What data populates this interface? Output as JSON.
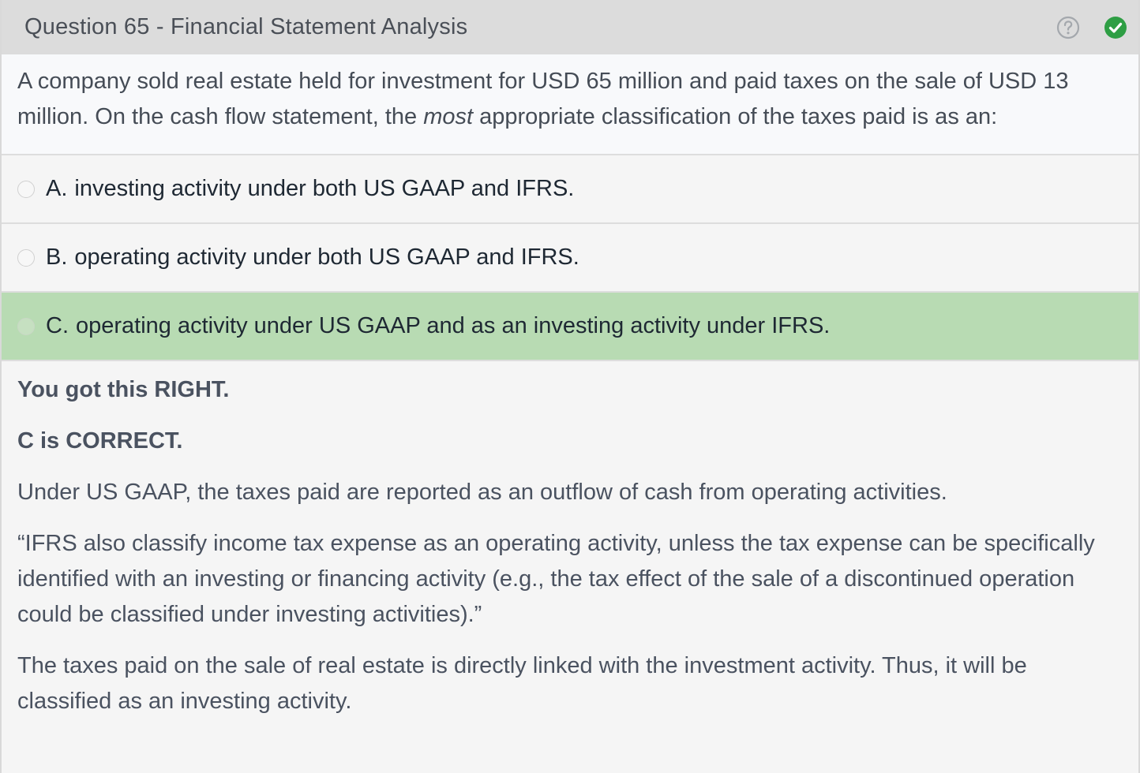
{
  "header": {
    "title": "Question 65 - Financial Statement Analysis",
    "help_icon": "question-circle-icon",
    "status_icon": "check-circle-icon",
    "status_color": "#2e9e44"
  },
  "question": {
    "stem_part1": "A company sold real estate held for investment for USD 65 million and paid taxes on the sale of USD 13 million.  On the cash flow statement, the ",
    "stem_emphasis": "most",
    "stem_part2": " appropriate classification of the taxes paid is as an:"
  },
  "choices": [
    {
      "letter": "A.",
      "text": "investing activity under both US GAAP and IFRS."
    },
    {
      "letter": "B.",
      "text": "operating activity under both US GAAP and IFRS."
    },
    {
      "letter": "C.",
      "text": "operating activity under US GAAP and as an investing activity under IFRS."
    }
  ],
  "selected_choice": "C",
  "correct_highlight_color": "#b8dbb3",
  "explanation": {
    "result": "You got this RIGHT.",
    "verdict": "C is CORRECT.",
    "paragraphs": [
      "Under US GAAP, the taxes paid are reported as an outflow of cash from operating activities.",
      "“IFRS also classify income tax expense as an operating activity, unless the tax expense can be specifically identified with an investing or financing activity (e.g., the tax effect of the sale of a discontinued operation could be classified under investing activities).”",
      "The taxes paid on the sale of real estate is directly linked with the investment activity.  Thus, it will be classified as an investing activity."
    ]
  }
}
